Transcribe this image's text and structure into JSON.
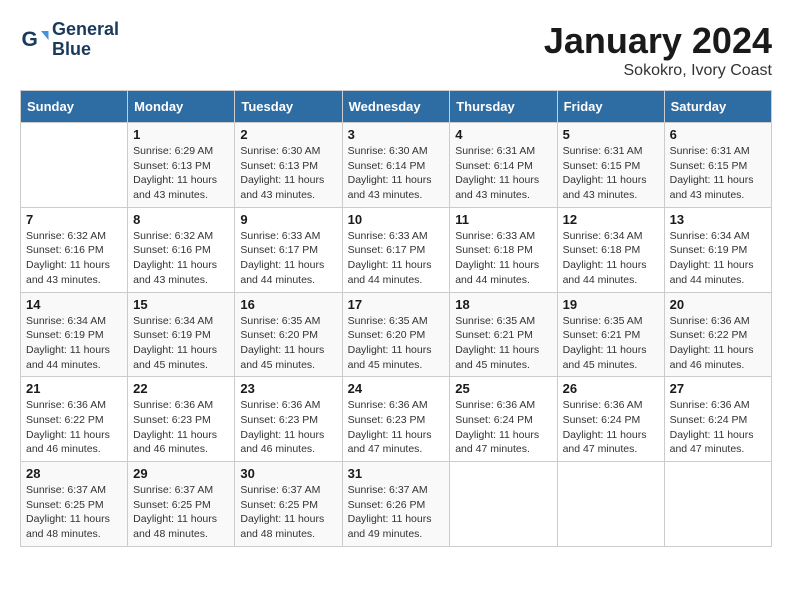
{
  "header": {
    "logo_line1": "General",
    "logo_line2": "Blue",
    "month_title": "January 2024",
    "location": "Sokokro, Ivory Coast"
  },
  "columns": [
    "Sunday",
    "Monday",
    "Tuesday",
    "Wednesday",
    "Thursday",
    "Friday",
    "Saturday"
  ],
  "weeks": [
    [
      null,
      {
        "day": 1,
        "sunrise": "6:29 AM",
        "sunset": "6:13 PM",
        "daylight": "11 hours and 43 minutes."
      },
      {
        "day": 2,
        "sunrise": "6:30 AM",
        "sunset": "6:13 PM",
        "daylight": "11 hours and 43 minutes."
      },
      {
        "day": 3,
        "sunrise": "6:30 AM",
        "sunset": "6:14 PM",
        "daylight": "11 hours and 43 minutes."
      },
      {
        "day": 4,
        "sunrise": "6:31 AM",
        "sunset": "6:14 PM",
        "daylight": "11 hours and 43 minutes."
      },
      {
        "day": 5,
        "sunrise": "6:31 AM",
        "sunset": "6:15 PM",
        "daylight": "11 hours and 43 minutes."
      },
      {
        "day": 6,
        "sunrise": "6:31 AM",
        "sunset": "6:15 PM",
        "daylight": "11 hours and 43 minutes."
      }
    ],
    [
      {
        "day": 7,
        "sunrise": "6:32 AM",
        "sunset": "6:16 PM",
        "daylight": "11 hours and 43 minutes."
      },
      {
        "day": 8,
        "sunrise": "6:32 AM",
        "sunset": "6:16 PM",
        "daylight": "11 hours and 43 minutes."
      },
      {
        "day": 9,
        "sunrise": "6:33 AM",
        "sunset": "6:17 PM",
        "daylight": "11 hours and 44 minutes."
      },
      {
        "day": 10,
        "sunrise": "6:33 AM",
        "sunset": "6:17 PM",
        "daylight": "11 hours and 44 minutes."
      },
      {
        "day": 11,
        "sunrise": "6:33 AM",
        "sunset": "6:18 PM",
        "daylight": "11 hours and 44 minutes."
      },
      {
        "day": 12,
        "sunrise": "6:34 AM",
        "sunset": "6:18 PM",
        "daylight": "11 hours and 44 minutes."
      },
      {
        "day": 13,
        "sunrise": "6:34 AM",
        "sunset": "6:19 PM",
        "daylight": "11 hours and 44 minutes."
      }
    ],
    [
      {
        "day": 14,
        "sunrise": "6:34 AM",
        "sunset": "6:19 PM",
        "daylight": "11 hours and 44 minutes."
      },
      {
        "day": 15,
        "sunrise": "6:34 AM",
        "sunset": "6:19 PM",
        "daylight": "11 hours and 45 minutes."
      },
      {
        "day": 16,
        "sunrise": "6:35 AM",
        "sunset": "6:20 PM",
        "daylight": "11 hours and 45 minutes."
      },
      {
        "day": 17,
        "sunrise": "6:35 AM",
        "sunset": "6:20 PM",
        "daylight": "11 hours and 45 minutes."
      },
      {
        "day": 18,
        "sunrise": "6:35 AM",
        "sunset": "6:21 PM",
        "daylight": "11 hours and 45 minutes."
      },
      {
        "day": 19,
        "sunrise": "6:35 AM",
        "sunset": "6:21 PM",
        "daylight": "11 hours and 45 minutes."
      },
      {
        "day": 20,
        "sunrise": "6:36 AM",
        "sunset": "6:22 PM",
        "daylight": "11 hours and 46 minutes."
      }
    ],
    [
      {
        "day": 21,
        "sunrise": "6:36 AM",
        "sunset": "6:22 PM",
        "daylight": "11 hours and 46 minutes."
      },
      {
        "day": 22,
        "sunrise": "6:36 AM",
        "sunset": "6:23 PM",
        "daylight": "11 hours and 46 minutes."
      },
      {
        "day": 23,
        "sunrise": "6:36 AM",
        "sunset": "6:23 PM",
        "daylight": "11 hours and 46 minutes."
      },
      {
        "day": 24,
        "sunrise": "6:36 AM",
        "sunset": "6:23 PM",
        "daylight": "11 hours and 47 minutes."
      },
      {
        "day": 25,
        "sunrise": "6:36 AM",
        "sunset": "6:24 PM",
        "daylight": "11 hours and 47 minutes."
      },
      {
        "day": 26,
        "sunrise": "6:36 AM",
        "sunset": "6:24 PM",
        "daylight": "11 hours and 47 minutes."
      },
      {
        "day": 27,
        "sunrise": "6:36 AM",
        "sunset": "6:24 PM",
        "daylight": "11 hours and 47 minutes."
      }
    ],
    [
      {
        "day": 28,
        "sunrise": "6:37 AM",
        "sunset": "6:25 PM",
        "daylight": "11 hours and 48 minutes."
      },
      {
        "day": 29,
        "sunrise": "6:37 AM",
        "sunset": "6:25 PM",
        "daylight": "11 hours and 48 minutes."
      },
      {
        "day": 30,
        "sunrise": "6:37 AM",
        "sunset": "6:25 PM",
        "daylight": "11 hours and 48 minutes."
      },
      {
        "day": 31,
        "sunrise": "6:37 AM",
        "sunset": "6:26 PM",
        "daylight": "11 hours and 49 minutes."
      },
      null,
      null,
      null
    ]
  ],
  "labels": {
    "sunrise": "Sunrise:",
    "sunset": "Sunset:",
    "daylight": "Daylight:"
  }
}
